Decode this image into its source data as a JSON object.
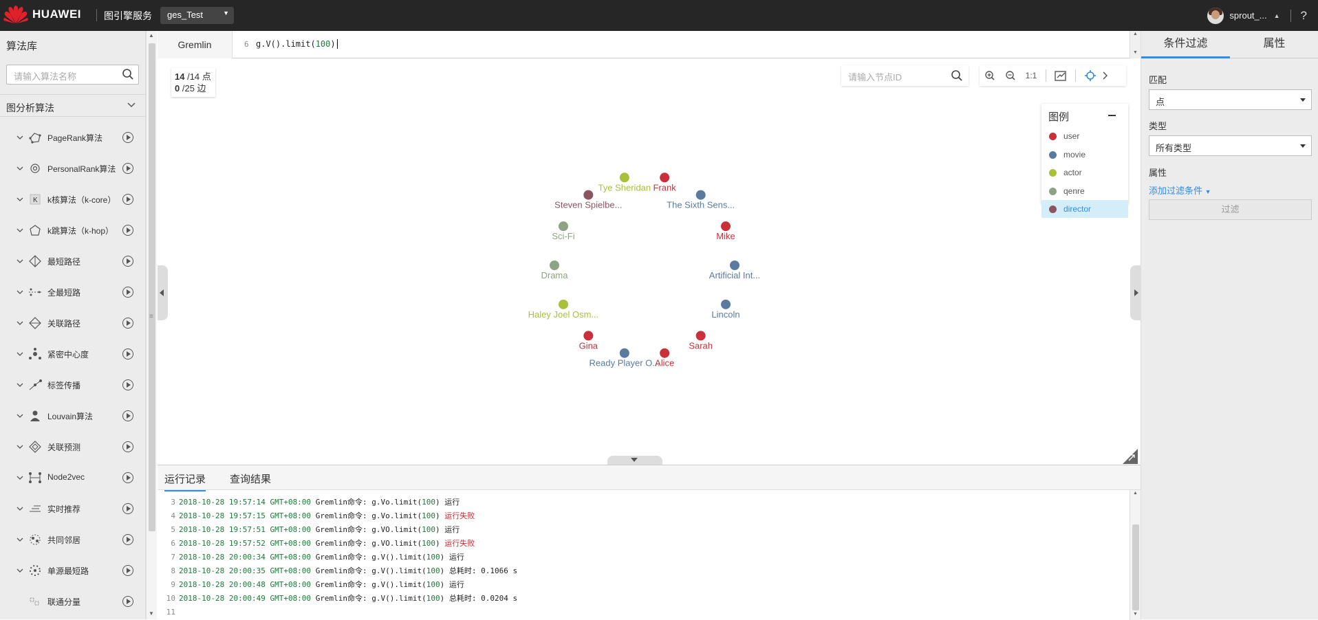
{
  "topbar": {
    "brand": "HUAWEI",
    "app_name": "图引擎服务",
    "graph_name": "ges_Test",
    "user_name": "sprout_...",
    "help": "?"
  },
  "sidebar": {
    "title": "算法库",
    "search_placeholder": "请输入算法名称",
    "category": "图分析算法",
    "items": [
      {
        "label": "PageRank算法",
        "icon": "pagerank-icon"
      },
      {
        "label": "PersonalRank算法",
        "icon": "personalrank-icon"
      },
      {
        "label": "k核算法（k-core）",
        "icon": "k-core-icon"
      },
      {
        "label": "k跳算法（k-hop）",
        "icon": "k-hop-icon"
      },
      {
        "label": "最短路径",
        "icon": "shortest-path-icon"
      },
      {
        "label": "全最短路",
        "icon": "all-shortest-paths-icon"
      },
      {
        "label": "关联路径",
        "icon": "association-path-icon"
      },
      {
        "label": "紧密中心度",
        "icon": "closeness-icon"
      },
      {
        "label": "标签传播",
        "icon": "label-propagation-icon"
      },
      {
        "label": "Louvain算法",
        "icon": "louvain-icon"
      },
      {
        "label": "关联预测",
        "icon": "link-prediction-icon"
      },
      {
        "label": "Node2vec",
        "icon": "node2vec-icon"
      },
      {
        "label": "实时推荐",
        "icon": "realtime-recommend-icon"
      },
      {
        "label": "共同邻居",
        "icon": "common-neighbors-icon"
      },
      {
        "label": "单源最短路",
        "icon": "sssp-icon"
      },
      {
        "label": "联通分量",
        "icon": "connected-components-icon"
      }
    ]
  },
  "editor": {
    "tab": "Gremlin",
    "line_no": "6",
    "code_prefix": "g.V().limit(",
    "code_num": "100",
    "code_suffix": ")"
  },
  "canvas": {
    "vertex_count": "14",
    "vertex_total": "/14 点",
    "edge_count": "0",
    "edge_total": "/25 边",
    "node_search_placeholder": "请输入节点ID",
    "zoom_reset": "1:1",
    "legend": {
      "title": "图例",
      "items": [
        {
          "label": "user",
          "color": "#c9303a"
        },
        {
          "label": "movie",
          "color": "#5a7a9e"
        },
        {
          "label": "actor",
          "color": "#a8c03a"
        },
        {
          "label": "qenre",
          "color": "#8fa283"
        },
        {
          "label": "director",
          "color": "#8b5560"
        }
      ],
      "selected": "director"
    },
    "nodes": [
      {
        "label": "Frank",
        "type": "user"
      },
      {
        "label": "The Sixth Sens...",
        "type": "movie"
      },
      {
        "label": "Mike",
        "type": "user"
      },
      {
        "label": "Artificial Int...",
        "type": "movie"
      },
      {
        "label": "Lincoln",
        "type": "movie"
      },
      {
        "label": "Sarah",
        "type": "user"
      },
      {
        "label": "Alice",
        "type": "user"
      },
      {
        "label": "Ready Player O...",
        "type": "movie"
      },
      {
        "label": "Gina",
        "type": "user"
      },
      {
        "label": "Haley Joel Osm...",
        "type": "actor"
      },
      {
        "label": "Drama",
        "type": "qenre"
      },
      {
        "label": "Sci-Fi",
        "type": "qenre"
      },
      {
        "label": "Steven Spielbe...",
        "type": "director"
      },
      {
        "label": "Tye Sheridan",
        "type": "actor"
      }
    ]
  },
  "log": {
    "tabs": [
      "运行记录",
      "查询结果"
    ],
    "lines": [
      {
        "n": "3",
        "ts": "2018-10-28 19:57:14 GMT+08:00",
        "cmd": "Gremlin命令: g.Vo.limit(",
        "num": "100",
        "tail": ")",
        "status": "运行",
        "fail": false
      },
      {
        "n": "4",
        "ts": "2018-10-28 19:57:15 GMT+08:00",
        "cmd": "Gremlin命令: g.Vo.limit(",
        "num": "100",
        "tail": ")",
        "status": "运行失败",
        "fail": true
      },
      {
        "n": "5",
        "ts": "2018-10-28 19:57:51 GMT+08:00",
        "cmd": "Gremlin命令: g.VO.limit(",
        "num": "100",
        "tail": ")",
        "status": "运行",
        "fail": false
      },
      {
        "n": "6",
        "ts": "2018-10-28 19:57:52 GMT+08:00",
        "cmd": "Gremlin命令: g.VO.limit(",
        "num": "100",
        "tail": ")",
        "status": "运行失败",
        "fail": true
      },
      {
        "n": "7",
        "ts": "2018-10-28 20:00:34 GMT+08:00",
        "cmd": "Gremlin命令: g.V().limit(",
        "num": "100",
        "tail": ")",
        "status": "运行",
        "fail": false
      },
      {
        "n": "8",
        "ts": "2018-10-28 20:00:35 GMT+08:00",
        "cmd": "Gremlin命令: g.V().limit(",
        "num": "100",
        "tail": ")",
        "status": "总耗时: 0.1066 s",
        "fail": false
      },
      {
        "n": "9",
        "ts": "2018-10-28 20:00:48 GMT+08:00",
        "cmd": "Gremlin命令: g.V().limit(",
        "num": "100",
        "tail": ")",
        "status": "运行",
        "fail": false
      },
      {
        "n": "10",
        "ts": "2018-10-28 20:00:49 GMT+08:00",
        "cmd": "Gremlin命令: g.V().limit(",
        "num": "100",
        "tail": ")",
        "status": "总耗时: 0.0204 s",
        "fail": false
      },
      {
        "n": "11",
        "ts": "",
        "cmd": "",
        "num": "",
        "tail": "",
        "status": "",
        "fail": false
      }
    ]
  },
  "right_panel": {
    "tabs": [
      "条件过滤",
      "属性"
    ],
    "match_label": "匹配",
    "match_value": "点",
    "type_label": "类型",
    "type_value": "所有类型",
    "attr_label": "属性",
    "add_filter": "添加过滤条件",
    "filter_button": "过滤"
  },
  "colors": {
    "accent": "#2d8cf0",
    "topbar": "#262626",
    "huawei_red": "#e4202b"
  }
}
